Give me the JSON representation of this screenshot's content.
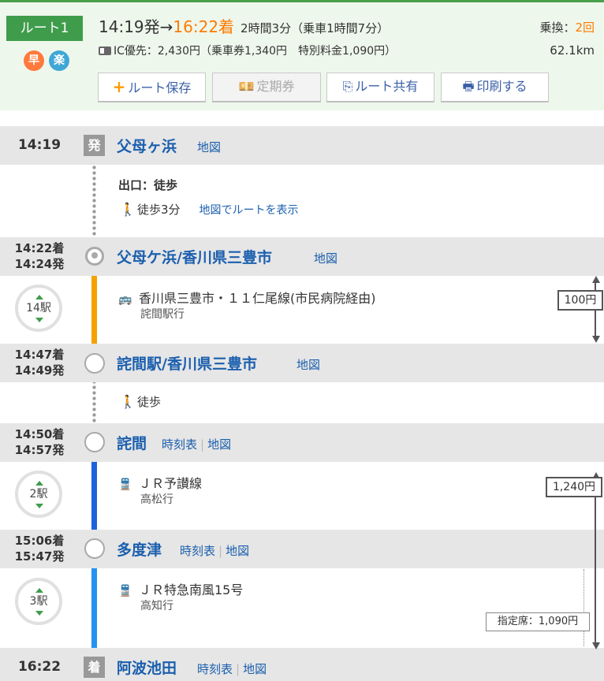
{
  "route": {
    "label": "ルート1",
    "fast_icon": "早",
    "easy_icon": "楽",
    "depart_time": "14:19発",
    "arrow": "→",
    "arrive_time": "16:22着",
    "duration": "2時間3分（乗車1時間7分）",
    "transfers_label": "乗換：",
    "transfers_count": "2回",
    "fare_summary": "IC優先：2,430円（乗車券1,340円　特別料金1,090円）",
    "distance": "62.1km"
  },
  "buttons": {
    "save": "ルート保存",
    "pass": "定期券",
    "share": "ルート共有",
    "print": "印刷する"
  },
  "stations": [
    {
      "time": "14:19",
      "tag": "発",
      "name": "父母ヶ浜",
      "map": "地図"
    },
    {
      "time_arr": "14:22着",
      "time_dep": "14:24発",
      "name": "父母ケ浜/香川県三豊市",
      "map": "地図"
    },
    {
      "time_arr": "14:47着",
      "time_dep": "14:49発",
      "name": "詫間駅/香川県三豊市",
      "map": "地図"
    },
    {
      "time_arr": "14:50着",
      "time_dep": "14:57発",
      "name": "詫間",
      "timetable": "時刻表",
      "map": "地図"
    },
    {
      "time_arr": "15:06着",
      "time_dep": "15:47発",
      "name": "多度津",
      "timetable": "時刻表",
      "map": "地図"
    },
    {
      "time": "16:22",
      "tag": "着",
      "name": "阿波池田",
      "timetable": "時刻表",
      "map": "地図"
    }
  ],
  "segments": {
    "walk1": {
      "exit_label": "出口：徒歩",
      "walk": "徒歩3分",
      "map_route": "地図でルートを表示"
    },
    "bus": {
      "stops": "14駅",
      "line": "香川県三豊市・１１仁尾線(市民病院経由)",
      "dest": "詫間駅行",
      "fare": "100円"
    },
    "walk2": {
      "walk": "徒歩"
    },
    "train1": {
      "stops": "2駅",
      "line": "ＪＲ予讃線",
      "dest": "高松行",
      "fare": "1,240円"
    },
    "train2": {
      "stops": "3駅",
      "line": "ＪＲ特急南風15号",
      "dest": "高知行",
      "fare": "指定席：1,090円"
    }
  },
  "colors": {
    "bus_line": "#f5a100",
    "train1_line": "#1e63dc",
    "train2_line": "#2592f0",
    "accent": "#3f9c4b",
    "link": "#1b5fae"
  }
}
